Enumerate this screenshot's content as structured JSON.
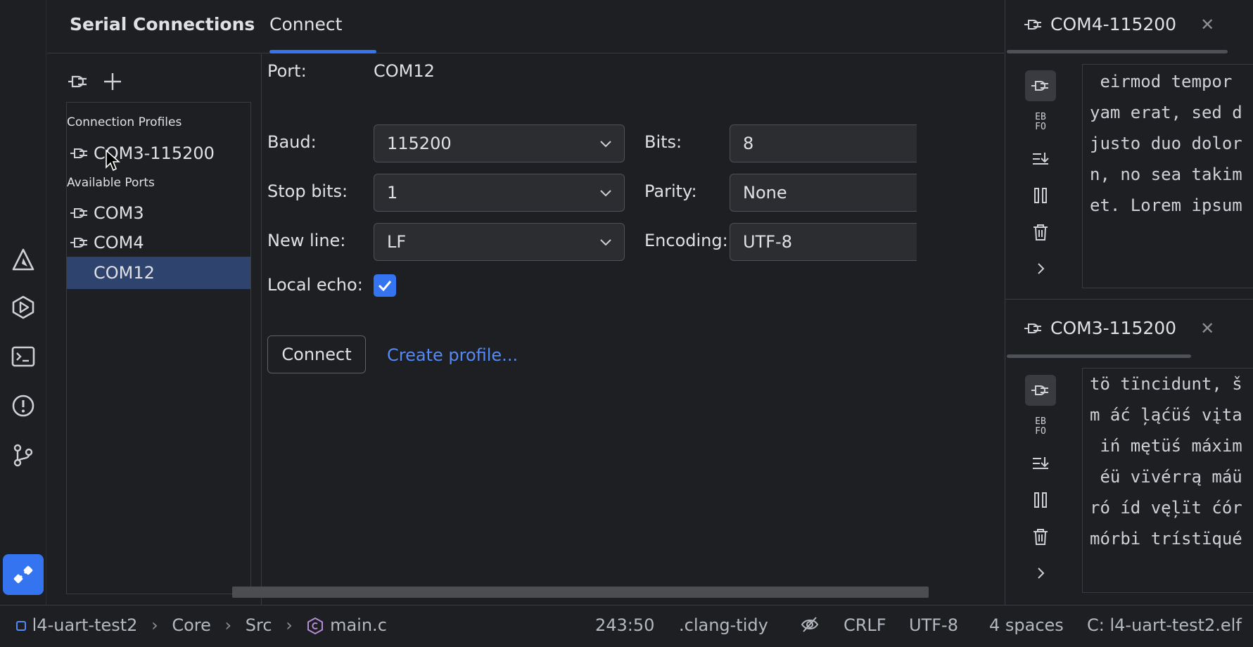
{
  "toolwindow": {
    "title": "Serial Connections",
    "tab": "Connect"
  },
  "tree": {
    "group_profiles": "Connection Profiles",
    "profiles": [
      {
        "label": "COM3-115200",
        "icon": "plug-icon"
      }
    ],
    "group_ports": "Available Ports",
    "ports": [
      {
        "label": "COM3",
        "icon": "plug-icon",
        "selected": false
      },
      {
        "label": "COM4",
        "icon": "plug-icon",
        "selected": false
      },
      {
        "label": "COM12",
        "icon": "",
        "selected": true
      }
    ]
  },
  "form": {
    "port_label": "Port:",
    "port_value": "COM12",
    "baud_label": "Baud:",
    "baud_value": "115200",
    "bits_label": "Bits:",
    "bits_value": "8",
    "stopbits_label": "Stop bits:",
    "stopbits_value": "1",
    "parity_label": "Parity:",
    "parity_value": "None",
    "newline_label": "New line:",
    "newline_value": "LF",
    "encoding_label": "Encoding:",
    "encoding_value": "UTF-8",
    "localecho_label": "Local echo:",
    "localecho_checked": true,
    "connect_button": "Connect",
    "create_profile_link": "Create profile..."
  },
  "terminals": [
    {
      "tab_title": "COM4-115200",
      "lines": [
        " eirmod tempor",
        "yam erat, sed d",
        "justo duo dolor",
        "n, no sea takim",
        "et. Lorem ipsum"
      ]
    },
    {
      "tab_title": "COM3-115200",
      "lines": [
        "tö tïncidunt, š",
        "m áć ļąćüś vįta",
        " iń mętüś máxim",
        " éü vïvérrą máü",
        "ró íd vęļït ćór",
        "mórbi trístïqué"
      ]
    }
  ],
  "terminal_tools": [
    "plug-icon",
    "hex-toggle-icon",
    "scroll-to-end-icon",
    "pause-icon",
    "trash-icon",
    "chevron-right-icon"
  ],
  "terminal_tools_hex_text": [
    "EB",
    "FO"
  ],
  "statusbar": {
    "project": "l4-uart-test2",
    "crumb1": "Core",
    "crumb2": "Src",
    "file": "main.c",
    "position": "243:50",
    "linter": ".clang-tidy",
    "line_ending": "CRLF",
    "encoding": "UTF-8",
    "indent": "4 spaces",
    "context": "C: l4-uart-test2.elf"
  },
  "colors": {
    "accent": "#3574f0",
    "selection": "#2e436e",
    "link": "#548af7"
  }
}
